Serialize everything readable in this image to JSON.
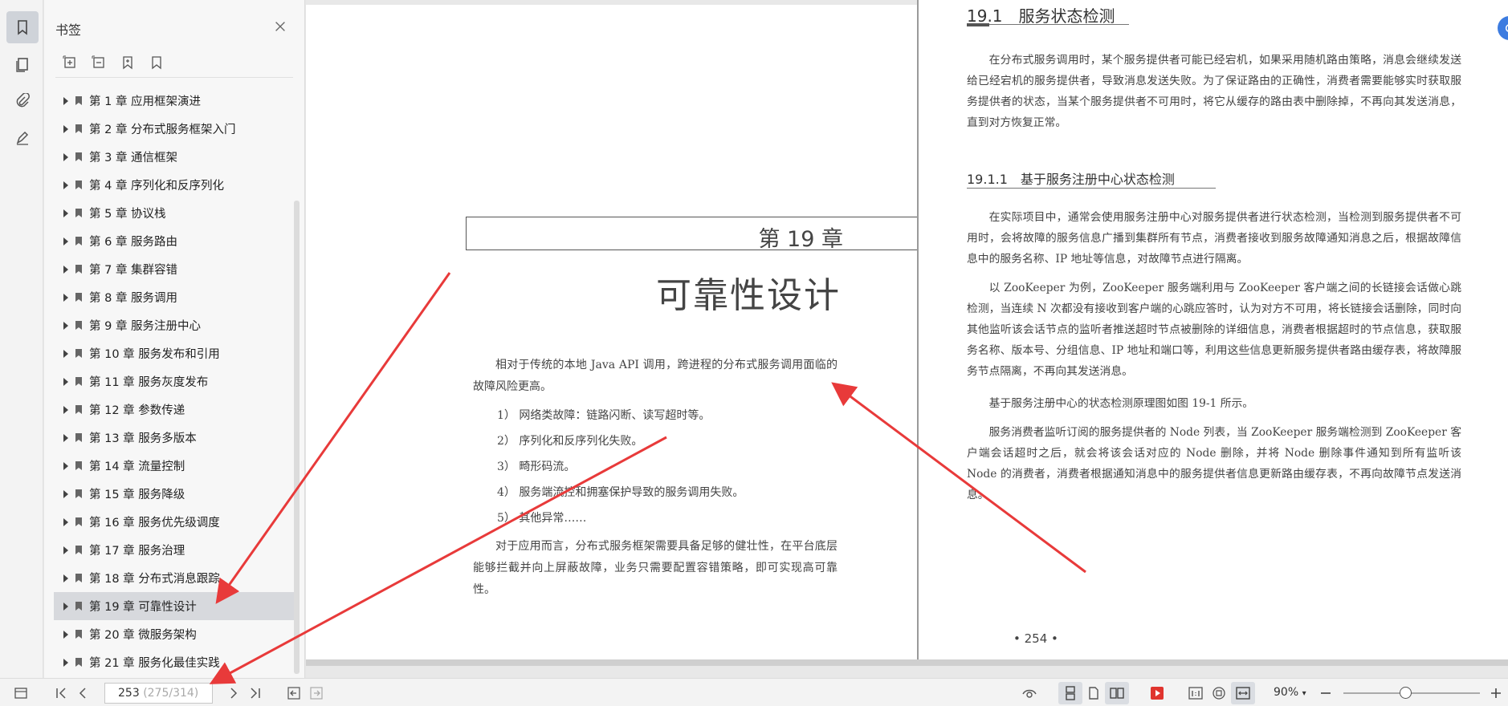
{
  "panel": {
    "title": "书签",
    "bookmarks": [
      {
        "label": "第 1 章 应用框架演进"
      },
      {
        "label": "第 2 章 分布式服务框架入门"
      },
      {
        "label": "第 3 章 通信框架"
      },
      {
        "label": "第 4 章 序列化和反序列化"
      },
      {
        "label": "第 5 章 协议栈"
      },
      {
        "label": "第 6 章 服务路由"
      },
      {
        "label": "第 7 章 集群容错"
      },
      {
        "label": "第 8 章 服务调用"
      },
      {
        "label": "第 9 章 服务注册中心"
      },
      {
        "label": "第 10 章 服务发布和引用"
      },
      {
        "label": "第 11 章 服务灰度发布"
      },
      {
        "label": "第 12 章 参数传递"
      },
      {
        "label": "第 13 章 服务多版本"
      },
      {
        "label": "第 14 章 流量控制"
      },
      {
        "label": "第 15 章 服务降级"
      },
      {
        "label": "第 16 章 服务优先级调度"
      },
      {
        "label": "第 17 章 服务治理"
      },
      {
        "label": "第 18 章 分布式消息跟踪"
      },
      {
        "label": "第 19 章 可靠性设计",
        "selected": true
      },
      {
        "label": "第 20 章 微服务架构"
      },
      {
        "label": "第 21 章 服务化最佳实践"
      }
    ]
  },
  "left_page": {
    "chapter_number": "第 19 章",
    "chapter_title": "可靠性设计",
    "intro": "相对于传统的本地 Java API 调用，跨进程的分布式服务调用面临的故障风险更高。",
    "list": [
      "1） 网络类故障：链路闪断、读写超时等。",
      "2） 序列化和反序列化失败。",
      "3） 畸形码流。",
      "4） 服务端流控和拥塞保护导致的服务调用失败。",
      "5） 其他异常……"
    ],
    "outro": "对于应用而言，分布式服务框架需要具备足够的健壮性，在平台底层能够拦截并向上屏蔽故障，业务只需要配置容错策略，即可实现高可靠性。"
  },
  "right_page": {
    "section_title": "19.1　服务状态检测",
    "section_para": "在分布式服务调用时，某个服务提供者可能已经宕机，如果采用随机路由策略，消息会继续发送给已经宕机的服务提供者，导致消息发送失败。为了保证路由的正确性，消费者需要能够实时获取服务提供者的状态，当某个服务提供者不可用时，将它从缓存的路由表中删除掉，不再向其发送消息，直到对方恢复正常。",
    "subsection_title": "19.1.1　基于服务注册中心状态检测",
    "paras": [
      "在实际项目中，通常会使用服务注册中心对服务提供者进行状态检测，当检测到服务提供者不可用时，会将故障的服务信息广播到集群所有节点，消费者接收到服务故障通知消息之后，根据故障信息中的服务名称、IP 地址等信息，对故障节点进行隔离。",
      "以 ZooKeeper 为例，ZooKeeper 服务端利用与 ZooKeeper 客户端之间的长链接会话做心跳检测，当连续 N 次都没有接收到客户端的心跳应答时，认为对方不可用，将长链接会话删除，同时向其他监听该会话节点的监听者推送超时节点被删除的详细信息，消费者根据超时的节点信息，获取服务名称、版本号、分组信息、IP 地址和端口等，利用这些信息更新服务提供者路由缓存表，将故障服务节点隔离，不再向其发送消息。",
      "基于服务注册中心的状态检测原理图如图 19-1 所示。",
      "服务消费者监听订阅的服务提供者的 Node 列表，当 ZooKeeper 服务端检测到 ZooKeeper 客户端会话超时之后，就会将该会话对应的 Node 删除，并将 Node 删除事件通知到所有监听该 Node 的消费者，消费者根据通知消息中的服务提供者信息更新路由缓存表，不再向故障节点发送消息。"
    ],
    "page_number": "• 254 •"
  },
  "status": {
    "current_page": "253",
    "total_pages": "(275/314)",
    "zoom": "90%",
    "zoom_level": 0.45
  },
  "colors": {
    "annotation_arrow": "#e83a3a",
    "play_button": "#e0342e",
    "float_button": "#3d7ce0"
  }
}
